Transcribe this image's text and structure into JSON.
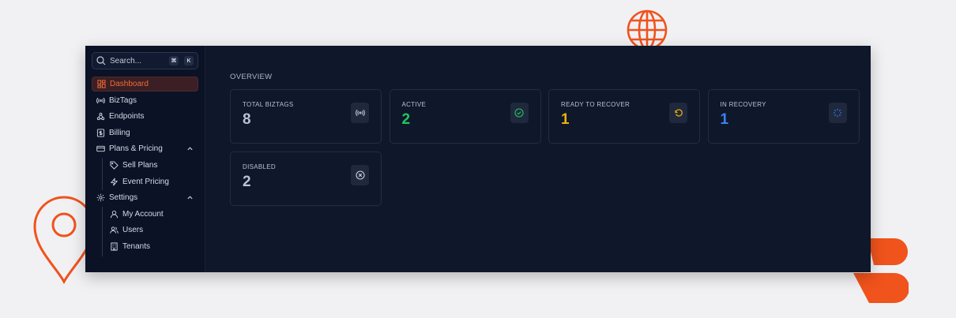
{
  "search": {
    "placeholder": "Search...",
    "shortcut": [
      "⌘",
      "K"
    ]
  },
  "sidebar": {
    "items": [
      {
        "label": "Dashboard",
        "icon": "dashboard-icon",
        "active": true
      },
      {
        "label": "BizTags",
        "icon": "broadcast-icon"
      },
      {
        "label": "Endpoints",
        "icon": "webhook-icon"
      },
      {
        "label": "Billing",
        "icon": "dollar-receipt-icon"
      },
      {
        "label": "Plans & Pricing",
        "icon": "credit-card-icon",
        "expanded": true,
        "children": [
          {
            "label": "Sell Plans",
            "icon": "tag-icon"
          },
          {
            "label": "Event Pricing",
            "icon": "zap-icon"
          }
        ]
      },
      {
        "label": "Settings",
        "icon": "gear-icon",
        "expanded": true,
        "children": [
          {
            "label": "My Account",
            "icon": "user-icon"
          },
          {
            "label": "Users",
            "icon": "users-icon"
          },
          {
            "label": "Tenants",
            "icon": "building-icon"
          }
        ]
      }
    ]
  },
  "overview": {
    "title": "OVERVIEW",
    "cards": [
      {
        "title": "TOTAL BIZTAGS",
        "value": "8",
        "color": "#b9c2d3",
        "icon": "broadcast-icon"
      },
      {
        "title": "ACTIVE",
        "value": "2",
        "color": "#22c55e",
        "icon": "check-circle-icon"
      },
      {
        "title": "READY TO RECOVER",
        "value": "1",
        "color": "#eab308",
        "icon": "rotate-ccw-icon"
      },
      {
        "title": "IN RECOVERY",
        "value": "1",
        "color": "#3b82f6",
        "icon": "loader-icon"
      },
      {
        "title": "DISABLED",
        "value": "2",
        "color": "#b9c2d3",
        "icon": "x-circle-icon"
      }
    ]
  },
  "colors": {
    "accent": "#f26b34",
    "background": "#0f172a",
    "sidebar": "#0b1226"
  }
}
